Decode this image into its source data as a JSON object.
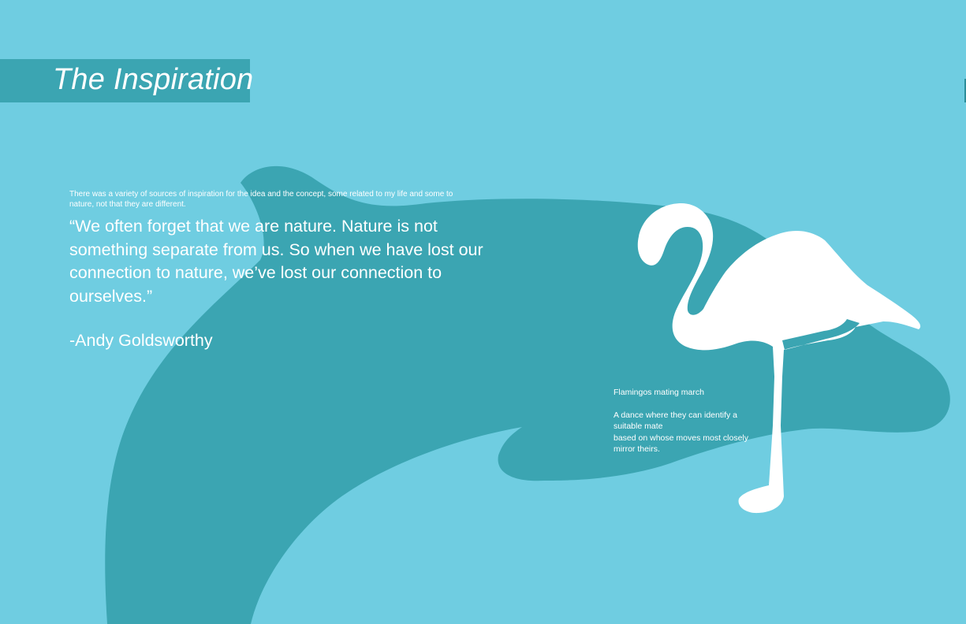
{
  "page": {
    "title": "The Inspiration",
    "intro_text": "There was a variety of sources of inspiration for the idea and the concept, some related to my life and some to nature, not that they are different.",
    "quote": "“We often forget that we are nature. Nature is not something separate from us. So when we have lost our connection to nature, we’ve lost our connection to ourselves.”",
    "author": "-Andy Goldsworthy"
  },
  "caption": {
    "title": "Flamingos mating march",
    "line1": "A dance where they can identify a suitable mate",
    "line2": "based on whose moves most closely mirror theirs."
  },
  "colors": {
    "background": "#6fcde1",
    "accent": "#3ba5b2",
    "text": "#ffffff"
  },
  "icons": {
    "silhouette": "flamingo-icon"
  }
}
